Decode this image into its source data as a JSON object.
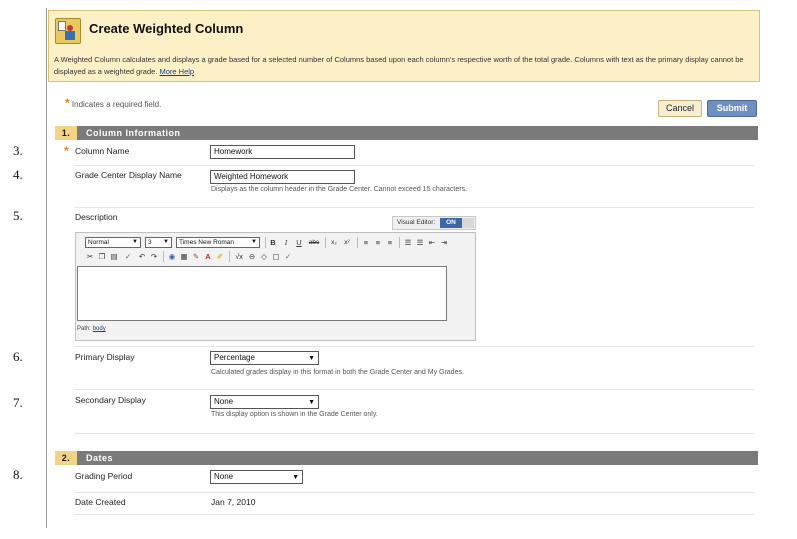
{
  "header": {
    "title": "Create Weighted Column",
    "description": "A Weighted Column calculates and displays a grade based for a selected number of Columns based upon each column's respective worth of the total grade. Columns with text as the primary display cannot be displayed as a weighted grade.",
    "more_help_link": "More Help"
  },
  "required_note": "Indicates a required field.",
  "buttons": {
    "cancel": "Cancel",
    "submit": "Submit"
  },
  "step_numbers": [
    "3.",
    "4.",
    "5.",
    "6.",
    "7.",
    "8."
  ],
  "section1": {
    "number": "1.",
    "title": "Column Information",
    "column_name": {
      "label": "Column Name",
      "value": "Homework"
    },
    "display_name": {
      "label": "Grade Center Display Name",
      "value": "Weighted Homework",
      "help": "Displays as the column header in the Grade Center. Cannot exceed 15 characters."
    },
    "description": {
      "label": "Description",
      "visual_editor_label": "Visual Editor:",
      "visual_editor_state": "ON",
      "format_select": "Normal",
      "size_select": "3",
      "font_select": "Times New Roman",
      "path_label": "Path:",
      "path_value": "body"
    },
    "primary_display": {
      "label": "Primary Display",
      "value": "Percentage",
      "help": "Calculated grades display in this format in both the Grade Center and My Grades."
    },
    "secondary_display": {
      "label": "Secondary Display",
      "value": "None",
      "help": "This display option is shown in the Grade Center only."
    }
  },
  "section2": {
    "number": "2.",
    "title": "Dates",
    "grading_period": {
      "label": "Grading Period",
      "value": "None"
    },
    "date_created": {
      "label": "Date Created",
      "value": "Jan 7, 2010"
    }
  },
  "toolbar_icons": {
    "row1": [
      "bold-icon",
      "italic-icon",
      "underline-icon",
      "strikethrough-icon",
      "subscript-icon",
      "superscript-icon",
      "align-left-icon",
      "align-center-icon",
      "align-right-icon",
      "ordered-list-icon",
      "unordered-list-icon",
      "outdent-icon",
      "indent-icon"
    ],
    "row2": [
      "cut-icon",
      "copy-icon",
      "paste-icon",
      "spellcheck-icon",
      "undo-icon",
      "redo-icon",
      "link-icon",
      "table-icon",
      "image-icon",
      "text-color-icon",
      "highlight-icon",
      "math-icon",
      "embed-icon",
      "html-icon",
      "preview-icon",
      "check-icon"
    ]
  },
  "colors": {
    "header_bg": "#fdf0c6",
    "section_bar": "#7a7a7a",
    "section_num_bg": "#f3d487",
    "submit_bg": "#6f8fc0",
    "required_star": "#e5801a"
  }
}
